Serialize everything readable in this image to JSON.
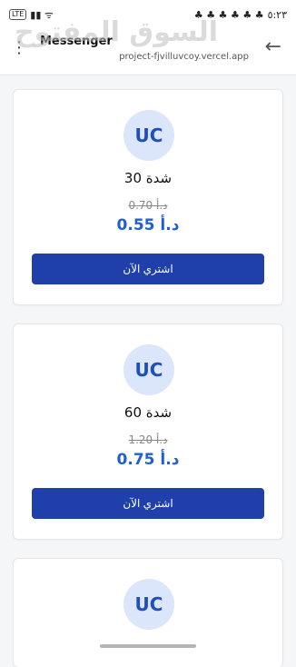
{
  "status_bar": {
    "left_badge": "LTE",
    "left_icons": "▮▮ ᯤ",
    "right_icons": "♣ ♣ ♣ ♣ ♣ ♣",
    "time": "٥:٢٣"
  },
  "watermark": "السوق المفتوح",
  "browser": {
    "page_name": "Messenger",
    "url": "project-fjvilluvcoy.vercel.app"
  },
  "currency": "د.أ",
  "badge_text": "UC",
  "offers": [
    {
      "amount": "30 شدة",
      "old_price": "0.70 د.أ",
      "new_price": "0.55 د.أ",
      "button": "اشتري الآن"
    },
    {
      "amount": "60 شدة",
      "old_price": "1.20 د.أ",
      "new_price": "0.75 د.أ",
      "button": "اشتري الآن"
    },
    {
      "amount": "",
      "old_price": "",
      "new_price": "",
      "button": ""
    }
  ],
  "colors": {
    "accent": "#1f3faa",
    "price": "#1f5fd1",
    "badge_bg": "#dbe6fb"
  }
}
